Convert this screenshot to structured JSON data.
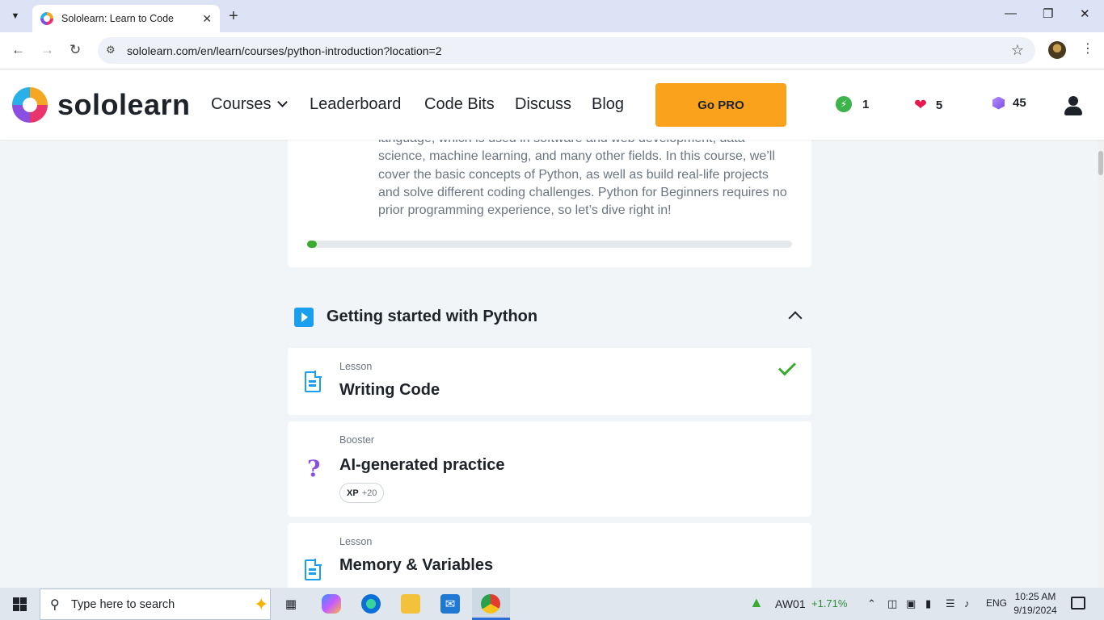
{
  "browser": {
    "tab_title": "Sololearn: Learn to Code",
    "url": "sololearn.com/en/learn/courses/python-introduction?location=2"
  },
  "site": {
    "logo_text": "sololearn",
    "nav": {
      "courses": "Courses",
      "leaderboard": "Leaderboard",
      "code_bits": "Code Bits",
      "discuss": "Discuss",
      "blog": "Blog"
    },
    "gopro_label": "Go PRO",
    "streak": "1",
    "hearts": "5",
    "gems": "45"
  },
  "course": {
    "description": "language, which is used in software and web development, data science, machine learning, and many other fields. In this course, we’ll cover the basic concepts of Python, as well as build real-life projects and solve different coding challenges. Python for Beginners requires no prior programming experience, so let’s dive right in!",
    "progress_percent": 2
  },
  "module": {
    "title": "Getting started with Python",
    "items": [
      {
        "kind": "Lesson",
        "name": "Writing Code",
        "completed": true
      },
      {
        "kind": "Booster",
        "name": "AI-generated practice",
        "xp_label": "XP",
        "xp_value": "+20"
      },
      {
        "kind": "Lesson",
        "name": "Memory & Variables"
      }
    ]
  },
  "taskbar": {
    "search_placeholder": "Type here to search",
    "stock_symbol": "AW01",
    "stock_change": "+1.71%",
    "language": "ENG",
    "time": "10:25 AM",
    "date": "9/19/2024"
  },
  "colors": {
    "accent_orange": "#fba21c",
    "progress_green": "#3caa2f",
    "lesson_blue": "#1a9eee",
    "booster_purple": "#8a4fe0"
  }
}
